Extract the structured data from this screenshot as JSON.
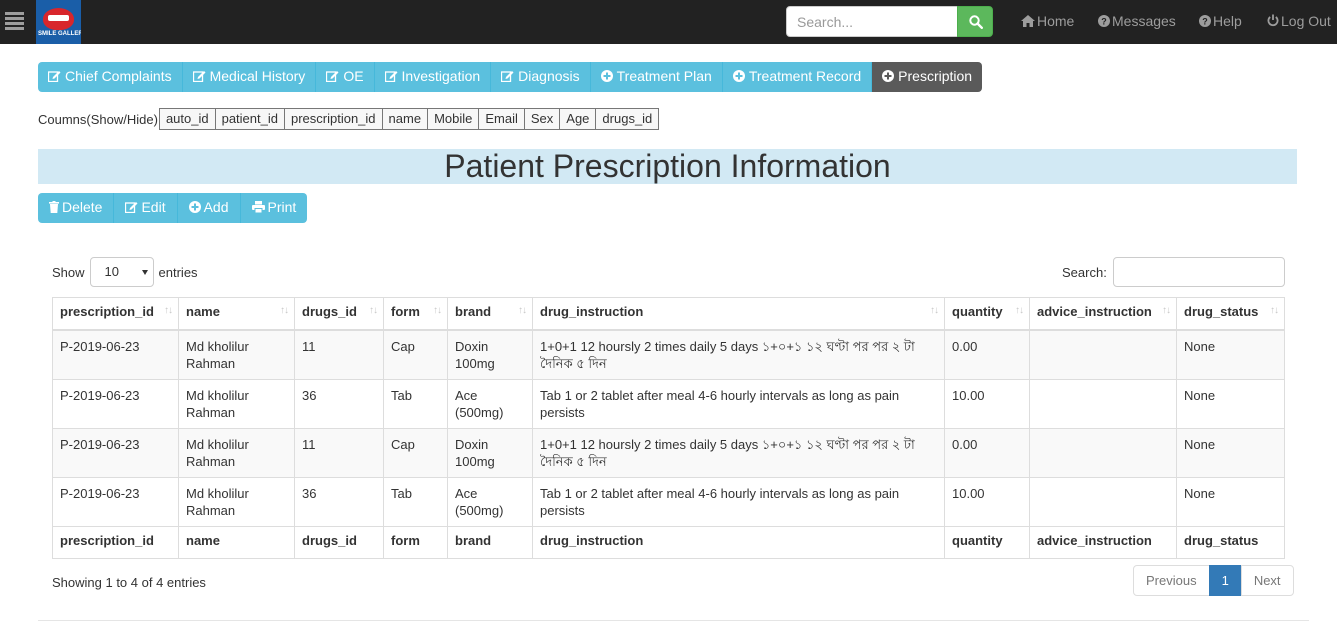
{
  "navbar": {
    "logo_text": "SMILE GALLERY",
    "search_placeholder": "Search...",
    "links": [
      {
        "label": "Home",
        "icon": "home-icon"
      },
      {
        "label": "Messages",
        "icon": "question-circle-icon"
      },
      {
        "label": "Help",
        "icon": "question-circle-icon"
      },
      {
        "label": "Log Out",
        "icon": "power-icon"
      }
    ]
  },
  "tabs": [
    {
      "label": "Chief Complaints",
      "icon": "edit-icon"
    },
    {
      "label": "Medical History",
      "icon": "edit-icon"
    },
    {
      "label": "OE",
      "icon": "edit-icon"
    },
    {
      "label": "Investigation",
      "icon": "edit-icon"
    },
    {
      "label": "Diagnosis",
      "icon": "edit-icon"
    },
    {
      "label": "Treatment Plan",
      "icon": "plus-circle-icon"
    },
    {
      "label": "Treatment Record",
      "icon": "plus-circle-icon"
    },
    {
      "label": "Prescription",
      "icon": "plus-circle-icon",
      "active": true
    }
  ],
  "column_toggle": {
    "label": "Coumns(Show/Hide)",
    "columns": [
      "auto_id",
      "patient_id",
      "prescription_id",
      "name",
      "Mobile",
      "Email",
      "Sex",
      "Age",
      "drugs_id"
    ]
  },
  "page_title": "Patient Prescription Information",
  "actions": [
    {
      "label": "Delete",
      "icon": "trash-icon"
    },
    {
      "label": "Edit",
      "icon": "edit-icon"
    },
    {
      "label": "Add",
      "icon": "plus-circle-icon"
    },
    {
      "label": "Print",
      "icon": "print-icon"
    }
  ],
  "table": {
    "length_label_before": "Show",
    "length_value": "10",
    "length_label_after": "entries",
    "search_label": "Search:",
    "columns": [
      "prescription_id",
      "name",
      "drugs_id",
      "form",
      "brand",
      "drug_instruction",
      "quantity",
      "advice_instruction",
      "drug_status"
    ],
    "rows": [
      [
        "P-2019-06-23",
        "Md kholilur Rahman",
        "11",
        "Cap",
        "Doxin 100mg",
        "1+0+1 12 hoursly 2 times daily 5 days ১+০+১ ১২ ঘণ্টা পর পর ২ টা দৈনিক ৫ দিন",
        "0.00",
        "",
        "None"
      ],
      [
        "P-2019-06-23",
        "Md kholilur Rahman",
        "36",
        "Tab",
        "Ace (500mg)",
        "Tab 1 or 2 tablet after meal 4-6 hourly intervals as long as pain persists",
        "10.00",
        "",
        "None"
      ],
      [
        "P-2019-06-23",
        "Md kholilur Rahman",
        "11",
        "Cap",
        "Doxin 100mg",
        "1+0+1 12 hoursly 2 times daily 5 days ১+০+১ ১২ ঘণ্টা পর পর ২ টা দৈনিক ৫ দিন",
        "0.00",
        "",
        "None"
      ],
      [
        "P-2019-06-23",
        "Md kholilur Rahman",
        "36",
        "Tab",
        "Ace (500mg)",
        "Tab 1 or 2 tablet after meal 4-6 hourly intervals as long as pain persists",
        "10.00",
        "",
        "None"
      ]
    ],
    "info": "Showing 1 to 4 of 4 entries",
    "pagination": {
      "previous": "Previous",
      "current": "1",
      "next": "Next"
    }
  }
}
